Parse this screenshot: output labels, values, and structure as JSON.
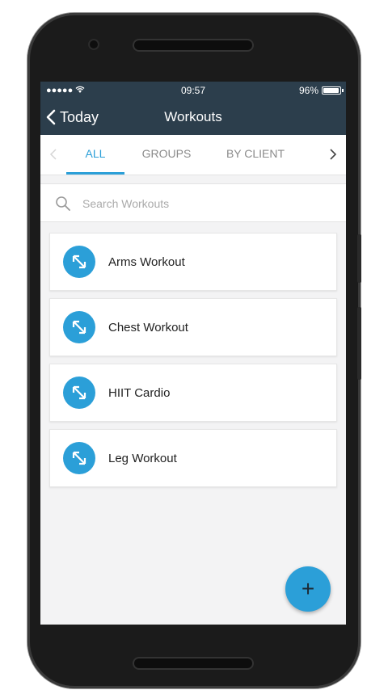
{
  "status_bar": {
    "signal": "●●●●● ",
    "time": "09:57",
    "battery_text": "96%",
    "battery_level_percent": 96
  },
  "nav": {
    "back_label": "Today",
    "title": "Workouts"
  },
  "tabs": [
    {
      "label": "ALL",
      "active": true
    },
    {
      "label": "GROUPS",
      "active": false
    },
    {
      "label": "BY CLIENT",
      "active": false
    }
  ],
  "search": {
    "placeholder": "Search Workouts"
  },
  "workouts": [
    {
      "label": "Arms Workout"
    },
    {
      "label": "Chest Workout"
    },
    {
      "label": "HIIT Cardio"
    },
    {
      "label": "Leg Workout"
    }
  ],
  "fab": {
    "label": "+"
  },
  "colors": {
    "header": "#2c3e4c",
    "accent": "#2b9fd8",
    "background": "#f3f3f4"
  },
  "icons": {
    "workout_item": "expand-arrows-icon",
    "back": "chevron-left-icon",
    "search": "search-icon"
  }
}
